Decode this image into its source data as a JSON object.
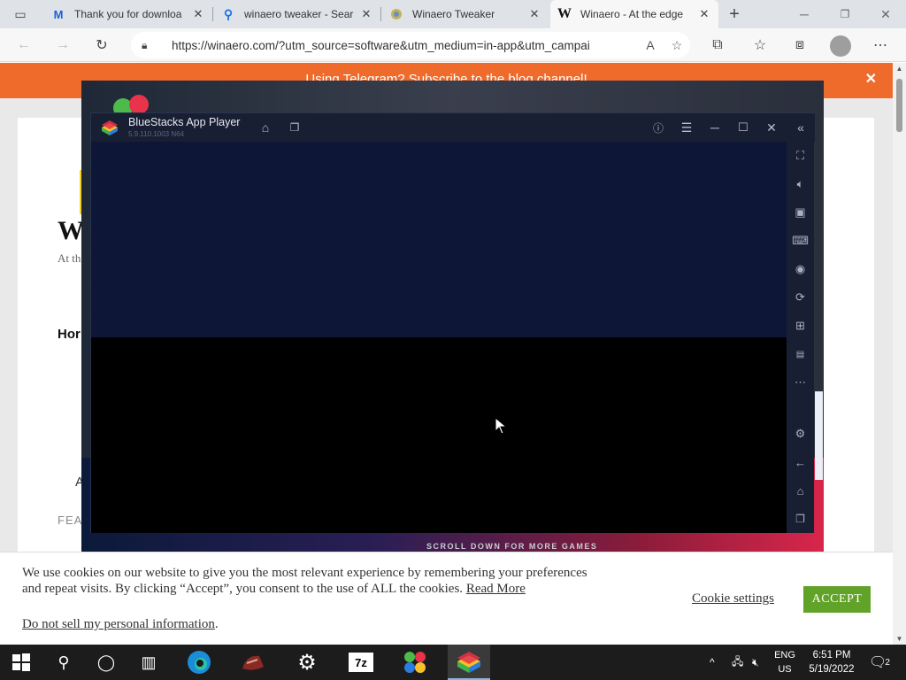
{
  "browser": {
    "tabs": [
      {
        "icon": "malwarebytes-icon",
        "title": "Thank you for downloa",
        "active": false
      },
      {
        "icon": "search-icon",
        "title": "winaero tweaker - Sear",
        "active": false
      },
      {
        "icon": "winaero-tweaker-icon",
        "title": "Winaero Tweaker",
        "active": false
      },
      {
        "icon": "winaero-w-icon",
        "title": "Winaero - At the edge",
        "active": true
      }
    ],
    "new_tab_symbol": "+",
    "tab_close_symbol": "✕",
    "address_bar": {
      "url": "https://winaero.com/?utm_source=software&utm_medium=in-app&utm_campai"
    }
  },
  "webpage": {
    "banner": {
      "text": "Using Telegram? Subscribe to the blog channel!",
      "close_symbol": "✕"
    },
    "site_logo_fragment": "W",
    "tagline_fragment": "At th",
    "home_nav_fragment": "Hor",
    "a_fragment": "A",
    "featured_fragment": "FEA",
    "cookie": {
      "message": "We use cookies on our website to give you the most relevant experience by remembering your preferences and repeat visits. By clicking “Accept”, you consent to the use of ALL the cookies.",
      "read_more": "Read More",
      "do_not_sell": "Do not sell my personal information",
      "do_not_sell_period": ".",
      "settings_label": "Cookie settings",
      "accept_label": "ACCEPT"
    }
  },
  "bluestacks": {
    "title": "BlueStacks App Player",
    "version": "5.9.110.1003 N64",
    "launcher_footer": "SCROLL DOWN FOR MORE GAMES",
    "title_icons": [
      "home-icon",
      "multi-instance-icon",
      "help-icon",
      "menu-icon",
      "minimize-icon",
      "maximize-icon",
      "close-icon",
      "collapse-sidebar-icon"
    ],
    "sidebar_icons": [
      "fullscreen-icon",
      "volume-icon",
      "media-icon",
      "keyboard-icon",
      "macro-icon",
      "rotate-icon",
      "gamepad-icon",
      "apk-icon",
      "more-icon",
      "settings-icon",
      "back-icon",
      "home-icon",
      "recent-apps-icon"
    ]
  },
  "taskbar": {
    "apps": [
      "start-icon",
      "search-icon",
      "cortana-icon",
      "task-view-icon",
      "edge-icon",
      "game-app-icon",
      "settings-icon",
      "7zip-icon",
      "bluestacks-multi-icon",
      "bluestacks-icon"
    ],
    "language_line1": "ENG",
    "language_line2": "US",
    "time": "6:51 PM",
    "date": "5/19/2022",
    "notification_count": "2"
  },
  "colors": {
    "banner": "#ee6b2c",
    "accept_button": "#61a229",
    "bluestacks_screen_top": "#0e1638"
  }
}
